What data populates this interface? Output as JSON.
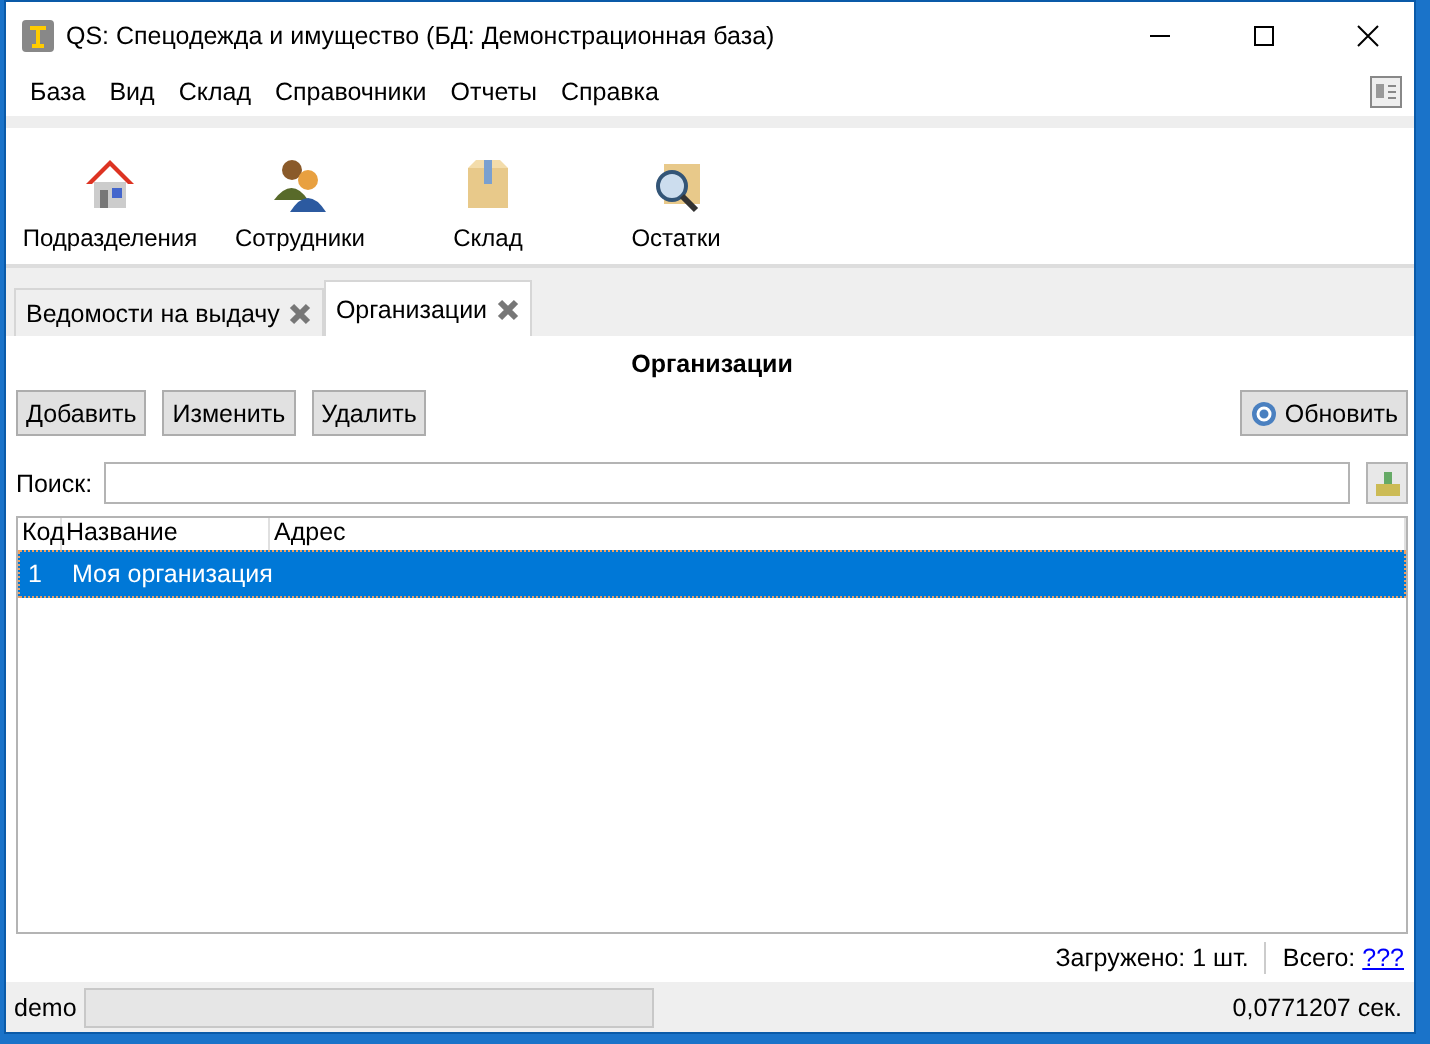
{
  "window": {
    "title": "QS: Спецодежда и имущество (БД: Демонстрационная база)"
  },
  "menu": [
    "База",
    "Вид",
    "Склад",
    "Справочники",
    "Отчеты",
    "Справка"
  ],
  "toolbar": [
    {
      "label": "Подразделения",
      "kind": "house"
    },
    {
      "label": "Сотрудники",
      "kind": "people"
    },
    {
      "label": "Склад",
      "kind": "box"
    },
    {
      "label": "Остатки",
      "kind": "search"
    }
  ],
  "tabs": [
    {
      "label": "Ведомости на выдачу",
      "selected": false
    },
    {
      "label": "Организации",
      "selected": true
    }
  ],
  "panel": {
    "title": "Организации",
    "buttons": [
      "Добавить",
      "Изменить",
      "Удалить"
    ],
    "refresh": "Обновить"
  },
  "search": {
    "label": "Поиск:"
  },
  "table": {
    "columns": [
      "Код",
      "Название",
      "Адрес"
    ],
    "rows": [
      {
        "cells": [
          "1",
          "Моя организация",
          ""
        ],
        "selected": true
      }
    ]
  },
  "footer": {
    "loaded": "Загружено: 1 шт.",
    "total_label": "Всего:",
    "total_link": "???"
  },
  "status_bar": {
    "user": "demo",
    "time": "0,0771207 сек."
  }
}
